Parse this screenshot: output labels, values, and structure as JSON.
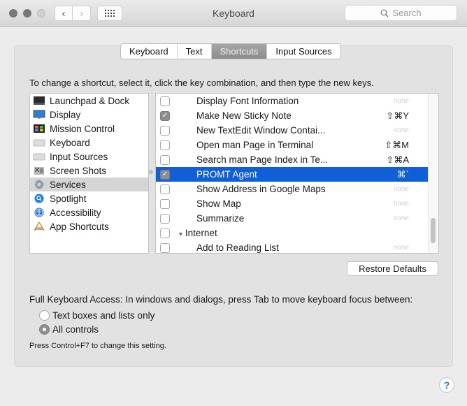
{
  "window": {
    "title": "Keyboard",
    "search_placeholder": "Search",
    "back_label": "‹",
    "forward_label": "›"
  },
  "tabs": [
    {
      "label": "Keyboard",
      "active": false
    },
    {
      "label": "Text",
      "active": false
    },
    {
      "label": "Shortcuts",
      "active": true
    },
    {
      "label": "Input Sources",
      "active": false
    }
  ],
  "instructions": "To change a shortcut, select it, click the key combination, and then type the new keys.",
  "categories": [
    {
      "label": "Launchpad & Dock",
      "icon": "launchpad-icon",
      "selected": false
    },
    {
      "label": "Display",
      "icon": "display-icon",
      "selected": false
    },
    {
      "label": "Mission Control",
      "icon": "mission-control-icon",
      "selected": false
    },
    {
      "label": "Keyboard",
      "icon": "keyboard-icon",
      "selected": false
    },
    {
      "label": "Input Sources",
      "icon": "input-sources-icon",
      "selected": false
    },
    {
      "label": "Screen Shots",
      "icon": "screen-shots-icon",
      "selected": false
    },
    {
      "label": "Services",
      "icon": "services-gear-icon",
      "selected": true
    },
    {
      "label": "Spotlight",
      "icon": "spotlight-icon",
      "selected": false
    },
    {
      "label": "Accessibility",
      "icon": "accessibility-icon",
      "selected": false
    },
    {
      "label": "App Shortcuts",
      "icon": "app-shortcuts-icon",
      "selected": false
    }
  ],
  "shortcuts": [
    {
      "label": "Display Font Information",
      "checked": false,
      "key": "none",
      "selected": false,
      "group": false
    },
    {
      "label": "Make New Sticky Note",
      "checked": true,
      "key": "⇧⌘Y",
      "selected": false,
      "group": false
    },
    {
      "label": "New TextEdit Window Contai...",
      "checked": false,
      "key": "none",
      "selected": false,
      "group": false
    },
    {
      "label": "Open man Page in Terminal",
      "checked": false,
      "key": "⇧⌘M",
      "selected": false,
      "group": false
    },
    {
      "label": "Search man Page Index in Te...",
      "checked": false,
      "key": "⇧⌘A",
      "selected": false,
      "group": false
    },
    {
      "label": "PROMT Agent",
      "checked": true,
      "key": "⌘`",
      "selected": true,
      "group": false
    },
    {
      "label": "Show Address in Google Maps",
      "checked": false,
      "key": "none",
      "selected": false,
      "group": false
    },
    {
      "label": "Show Map",
      "checked": false,
      "key": "none",
      "selected": false,
      "group": false
    },
    {
      "label": "Summarize",
      "checked": false,
      "key": "none",
      "selected": false,
      "group": false
    },
    {
      "label": "Internet",
      "checked": false,
      "key": "",
      "selected": false,
      "group": true
    },
    {
      "label": "Add to Reading List",
      "checked": false,
      "key": "none",
      "selected": false,
      "group": false
    }
  ],
  "restore_defaults_label": "Restore Defaults",
  "full_keyboard_access": {
    "label": "Full Keyboard Access: In windows and dialogs, press Tab to move keyboard focus between:",
    "options": [
      {
        "label": "Text boxes and lists only",
        "selected": false
      },
      {
        "label": "All controls",
        "selected": true
      }
    ],
    "hint": "Press Control+F7 to change this setting."
  },
  "help_label": "?",
  "colors": {
    "selection": "#0e5fd8",
    "help_accent": "#1a7ee6"
  }
}
